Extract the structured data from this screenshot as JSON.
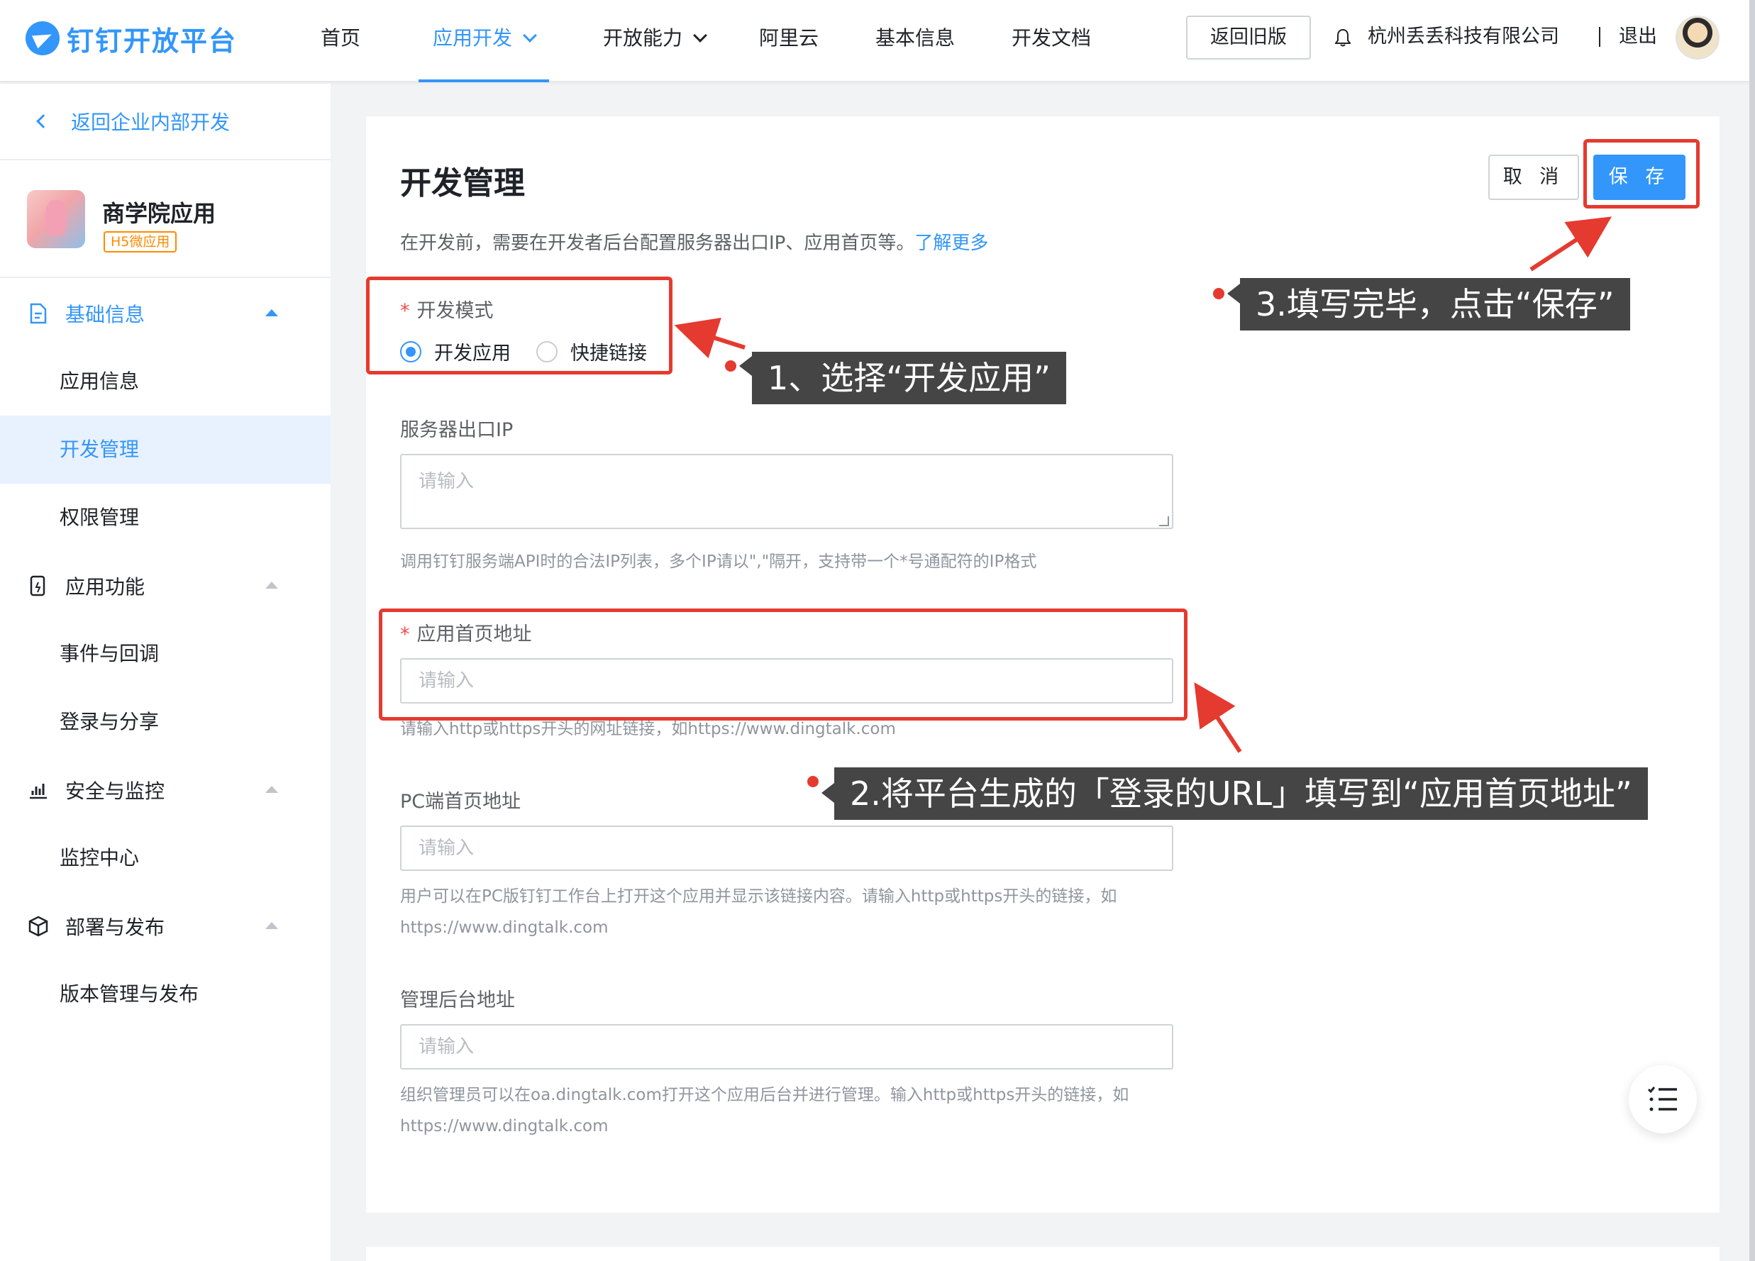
{
  "topbar": {
    "logo": "钉钉开放平台",
    "nav": [
      {
        "label": "首页"
      },
      {
        "label": "应用开发"
      },
      {
        "label": "开放能力"
      },
      {
        "label": "阿里云"
      },
      {
        "label": "基本信息"
      },
      {
        "label": "开发文档"
      }
    ],
    "old_version": "返回旧版",
    "company": "杭州丢丢科技有限公司",
    "logout": "退出"
  },
  "sidebar": {
    "back": "返回企业内部开发",
    "app": {
      "name": "商学院应用",
      "tag": "H5微应用"
    },
    "groups": [
      {
        "label": "基础信息",
        "items": [
          "应用信息",
          "开发管理",
          "权限管理"
        ]
      },
      {
        "label": "应用功能",
        "items": [
          "事件与回调",
          "登录与分享"
        ]
      },
      {
        "label": "安全与监控",
        "items": [
          "监控中心"
        ]
      },
      {
        "label": "部署与发布",
        "items": [
          "版本管理与发布"
        ]
      }
    ]
  },
  "main": {
    "title": "开发管理",
    "desc": "在开发前，需要在开发者后台配置服务器出口IP、应用首页等。",
    "learn_more": "了解更多",
    "cancel": "取 消",
    "save": "保 存",
    "dev_mode": {
      "label": "开发模式",
      "options": [
        "开发应用",
        "快捷链接"
      ],
      "selected": "开发应用"
    },
    "server_ip": {
      "label": "服务器出口IP",
      "placeholder": "请输入",
      "hint": "调用钉钉服务端API时的合法IP列表，多个IP请以\",\"隔开，支持带一个*号通配符的IP格式"
    },
    "home_url": {
      "label": "应用首页地址",
      "placeholder": "请输入",
      "hint": "请输入http或https开头的网址链接，如https://www.dingtalk.com"
    },
    "pc_url": {
      "label": "PC端首页地址",
      "placeholder": "请输入",
      "hint": "用户可以在PC版钉钉工作台上打开这个应用并显示该链接内容。请输入http或https开头的链接，如https://www.dingtalk.com"
    },
    "admin_url": {
      "label": "管理后台地址",
      "placeholder": "请输入",
      "hint": "组织管理员可以在oa.dingtalk.com打开这个应用后台并进行管理。输入http或https开头的链接，如https://www.dingtalk.com"
    }
  },
  "annotations": {
    "step1": "1、选择“开发应用”",
    "step2": "2.将平台生成的「登录的URL」填写到“应用首页地址”",
    "step3": "3.填写完毕，点击“保存”"
  },
  "colors": {
    "accent": "#3296fa",
    "annotation_red": "#e53a2f",
    "callout_bg": "#454545"
  }
}
